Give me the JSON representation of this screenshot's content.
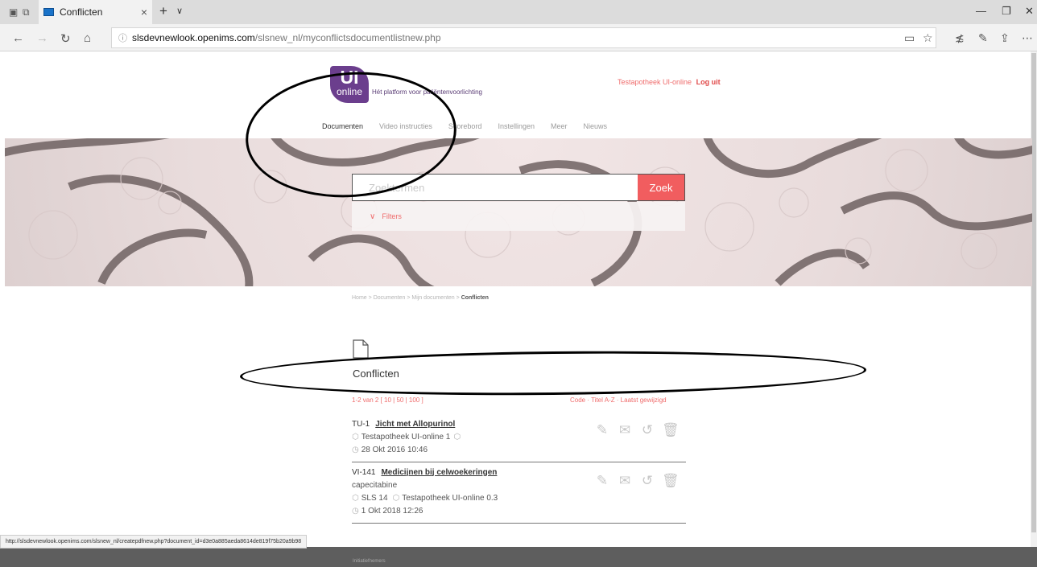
{
  "browser": {
    "tab": {
      "title": "Conflicten"
    },
    "address": {
      "host": "slsdevnewlook.openims.com",
      "path": "/slsnew_nl/myconflictsdocumentlistnew.php"
    },
    "status_url": "http://slsdevnewlook.openims.com/slsnew_nl/createpdfnew.php?document_id=d3e0a885aeda8614de819f75b20a9b98"
  },
  "site": {
    "logo": {
      "big": "UI",
      "small": "online"
    },
    "tagline": "Hét platform voor patiëntenvoorlichting",
    "account": {
      "org": "Testapotheek UI-online",
      "logout": "Log uit"
    },
    "nav": [
      {
        "label": "Documenten",
        "active": true
      },
      {
        "label": "Video instructies"
      },
      {
        "label": "Scorebord"
      },
      {
        "label": "Instellingen"
      },
      {
        "label": "Meer"
      },
      {
        "label": "Nieuws"
      }
    ],
    "search": {
      "placeholder": "Zoektermen",
      "button": "Zoek"
    },
    "filters": {
      "label": "Filters"
    }
  },
  "breadcrumb": {
    "items": [
      "Home",
      "Documenten",
      "Mijn documenten"
    ],
    "current": "Conflicten",
    "separator": ">"
  },
  "content": {
    "title": "Conflicten",
    "pager": {
      "text": "1-2 van 2",
      "sizes": "[ 10 | 50 | 100 ]"
    },
    "sorting": {
      "text": "Code · Titel A-Z · Laatst gewijzigd"
    },
    "documents": [
      {
        "code": "TU-1",
        "title": "Jicht met Allopurinol",
        "subtitle": "",
        "meta": "Testapotheek UI-online 1",
        "date": "28 Okt 2016 10:46"
      },
      {
        "code": "VI-141",
        "title": "Medicijnen bij celwoekeringen",
        "subtitle": "capecitabine",
        "meta_a": "SLS 14",
        "meta": "Testapotheek UI-online 0.3",
        "date": "1 Okt 2018 12:26"
      }
    ]
  },
  "footer": {
    "label": "Initiatiefnemers"
  },
  "colors": {
    "accent": "#f15d5f",
    "brand": "#6b3e8d",
    "footer": "#5e5e5e"
  }
}
